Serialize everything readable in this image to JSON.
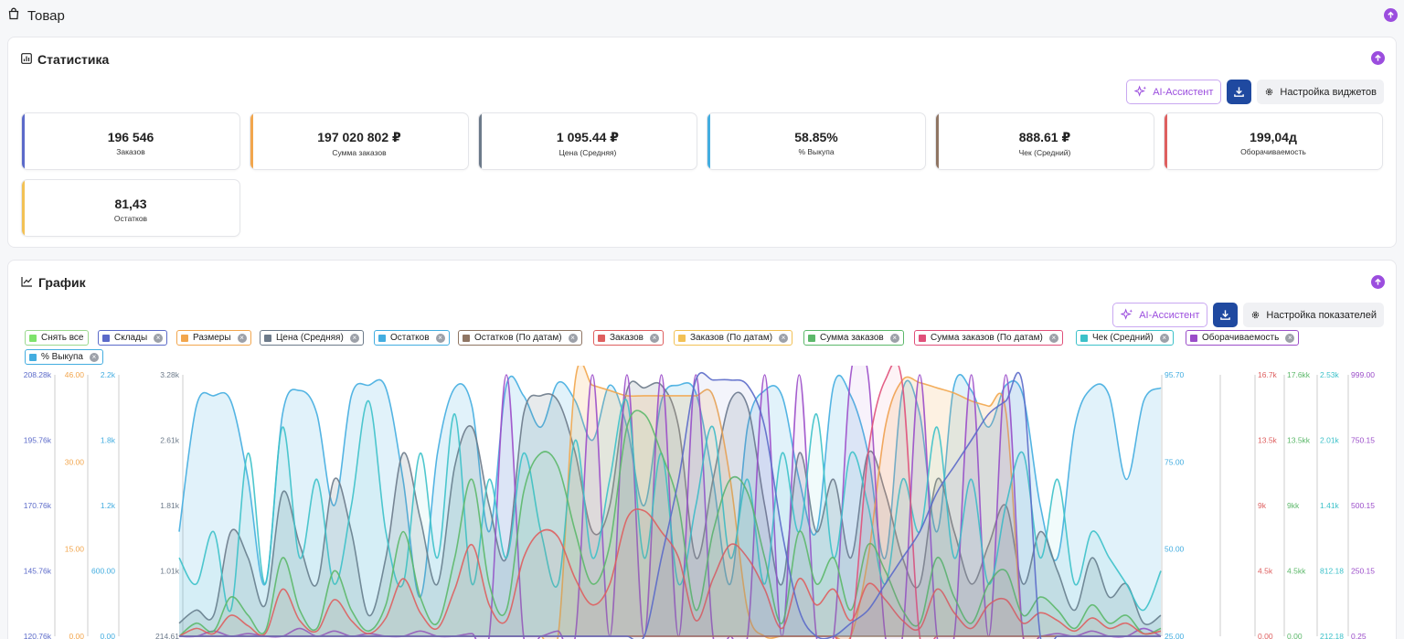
{
  "header": {
    "title": "Товар"
  },
  "stats": {
    "title": "Статистика",
    "ai_label": "AI-Ассистент",
    "settings_label": "Настройка виджетов",
    "metrics": [
      {
        "value": "196 546",
        "label": "Заказов",
        "color": "#5b6ac9"
      },
      {
        "value": "197 020 802 ₽",
        "label": "Сумма заказов",
        "color": "#f2a64d"
      },
      {
        "value": "1 095.44 ₽",
        "label": "Цена (Средняя)",
        "color": "#6c7a8a"
      },
      {
        "value": "58.85%",
        "label": "% Выкупа",
        "color": "#43ade0"
      },
      {
        "value": "888.61 ₽",
        "label": "Чек (Средний)",
        "color": "#8f7563"
      },
      {
        "value": "199,04д",
        "label": "Оборачиваемость",
        "color": "#de5f5f"
      },
      {
        "value": "81,43",
        "label": "Остатков",
        "color": "#f2c155"
      }
    ]
  },
  "graph": {
    "title": "График",
    "ai_label": "AI-Ассистент",
    "settings_label": "Настройка показателей",
    "chips": [
      {
        "label": "Снять все",
        "color": "#7ee36b",
        "border": "#9bd88f",
        "removable": false
      },
      {
        "label": "Склады",
        "color": "#5b6ac9",
        "border": "#5b6ac9",
        "removable": true
      },
      {
        "label": "Размеры",
        "color": "#f2a64d",
        "border": "#f2a64d",
        "removable": true
      },
      {
        "label": "Цена (Средняя)",
        "color": "#6c7a8a",
        "border": "#6c7a8a",
        "removable": true
      },
      {
        "label": "Остатков",
        "color": "#43ade0",
        "border": "#43ade0",
        "removable": true
      },
      {
        "label": "Остатков (По датам)",
        "color": "#8f7563",
        "border": "#8f7563",
        "removable": true
      },
      {
        "label": "Заказов",
        "color": "#de5f5f",
        "border": "#de5f5f",
        "removable": true
      },
      {
        "label": "Заказов (По датам)",
        "color": "#f2c155",
        "border": "#f2c155",
        "removable": true
      },
      {
        "label": "Сумма заказов",
        "color": "#5cb86a",
        "border": "#5cb86a",
        "removable": true
      },
      {
        "label": "Сумма заказов (По датам)",
        "color": "#e0507a",
        "border": "#e0507a",
        "removable": true
      },
      {
        "label": "Чек (Средний)",
        "color": "#3cc1c9",
        "border": "#3cc1c9",
        "removable": true
      },
      {
        "label": "Оборачиваемость",
        "color": "#9b4dc9",
        "border": "#9b4dc9",
        "removable": true
      },
      {
        "label": "% Выкупа",
        "color": "#43ade0",
        "border": "#43ade0",
        "removable": true
      }
    ]
  },
  "chart_data": {
    "type": "area",
    "left_axes": [
      {
        "color": "#5b6ac9",
        "ticks": [
          "208.28k",
          "195.76k",
          "170.76k",
          "145.76k",
          "120.76k"
        ]
      },
      {
        "color": "#f2a64d",
        "ticks": [
          "46.00",
          "30.00",
          "15.00",
          "0.00"
        ]
      },
      {
        "color": "#43ade0",
        "ticks": [
          "2.2k",
          "1.8k",
          "1.2k",
          "600.00",
          "0.00"
        ]
      },
      {
        "color": "#6c7a8a",
        "ticks": [
          "3.28k",
          "2.61k",
          "1.81k",
          "1.01k",
          "214.61"
        ]
      }
    ],
    "right_axes": [
      {
        "color": "#43ade0",
        "ticks": [
          "95.70",
          "75.00",
          "50.00",
          "25.00"
        ]
      },
      {
        "color": "#de5f5f",
        "ticks": [
          "16.7k",
          "13.5k",
          "9k",
          "4.5k",
          "0.00"
        ]
      },
      {
        "color": "#5cb86a",
        "ticks": [
          "17.6kk",
          "13.5kk",
          "9kk",
          "4.5kk",
          "0.00"
        ]
      },
      {
        "color": "#3cc1c9",
        "ticks": [
          "2.53k",
          "2.01k",
          "1.41k",
          "812.18",
          "212.18"
        ]
      },
      {
        "color": "#9b4dc9",
        "ticks": [
          "999.00",
          "750.15",
          "500.15",
          "250.15",
          "0.25"
        ]
      }
    ],
    "series": [
      {
        "color": "#43ade0",
        "values": [
          40,
          88,
          92,
          90,
          60,
          20,
          85,
          94,
          85,
          50,
          92,
          96,
          95,
          60,
          15,
          70,
          95,
          88,
          40,
          96,
          92,
          80,
          97,
          90,
          75,
          96,
          80,
          50,
          90,
          96,
          93,
          60,
          20,
          80,
          94,
          92,
          60,
          40,
          96,
          92,
          70,
          30,
          94,
          85,
          40,
          96,
          94,
          80,
          96,
          92,
          50,
          30,
          80,
          95,
          92,
          60,
          90,
          95
        ]
      },
      {
        "color": "#6c7a8a",
        "values": [
          5,
          10,
          8,
          40,
          30,
          12,
          55,
          35,
          20,
          60,
          40,
          8,
          30,
          70,
          45,
          20,
          65,
          80,
          50,
          30,
          85,
          92,
          90,
          70,
          40,
          50,
          94,
          95,
          96,
          80,
          30,
          60,
          90,
          88,
          50,
          20,
          70,
          40,
          60,
          30,
          70,
          55,
          30,
          20,
          60,
          40,
          20,
          35,
          50,
          20,
          40,
          25,
          10,
          30,
          15,
          20,
          5,
          8
        ]
      },
      {
        "color": "#f2a64d",
        "values": [
          0,
          0,
          0,
          0,
          0,
          0,
          0,
          0,
          0,
          0,
          0,
          0,
          0,
          0,
          0,
          0,
          0,
          0,
          0,
          0,
          0,
          0,
          0,
          98,
          96,
          94,
          92,
          92,
          92,
          92,
          92,
          92,
          60,
          10,
          0,
          0,
          0,
          0,
          0,
          0,
          30,
          80,
          98,
          97,
          95,
          93,
          90,
          88,
          86,
          0,
          0,
          0,
          0,
          0,
          0,
          0,
          0,
          0
        ]
      },
      {
        "color": "#9b4dc9",
        "values": [
          0,
          0,
          2,
          0,
          1,
          0,
          0,
          3,
          0,
          2,
          0,
          1,
          0,
          0,
          2,
          0,
          0,
          1,
          0,
          100,
          0,
          0,
          2,
          0,
          100,
          0,
          100,
          0,
          100,
          0,
          100,
          0,
          0,
          0,
          100,
          0,
          100,
          0,
          0,
          100,
          100,
          0,
          0,
          100,
          0,
          0,
          100,
          0,
          100,
          0,
          0,
          1,
          0,
          2,
          0,
          0,
          3,
          0
        ]
      },
      {
        "color": "#3cc1c9",
        "values": [
          30,
          20,
          40,
          10,
          70,
          20,
          80,
          30,
          60,
          20,
          50,
          90,
          40,
          20,
          70,
          30,
          85,
          20,
          60,
          30,
          70,
          40,
          20,
          75,
          30,
          60,
          90,
          30,
          70,
          20,
          50,
          80,
          30,
          60,
          20,
          70,
          40,
          85,
          30,
          70,
          50,
          20,
          60,
          40,
          80,
          30,
          60,
          20,
          50,
          70,
          30,
          60,
          20,
          40,
          30,
          20,
          10,
          25
        ]
      },
      {
        "color": "#5cb86a",
        "values": [
          0,
          5,
          2,
          15,
          8,
          2,
          30,
          10,
          3,
          25,
          10,
          2,
          12,
          40,
          15,
          5,
          30,
          60,
          20,
          10,
          55,
          70,
          65,
          40,
          20,
          35,
          80,
          85,
          70,
          50,
          10,
          40,
          60,
          55,
          30,
          5,
          40,
          20,
          30,
          10,
          35,
          25,
          10,
          5,
          30,
          15,
          5,
          20,
          25,
          8,
          15,
          10,
          3,
          12,
          5,
          8,
          1,
          3
        ]
      },
      {
        "color": "#de5f5f",
        "values": [
          0,
          3,
          1,
          8,
          4,
          1,
          18,
          6,
          2,
          14,
          6,
          1,
          7,
          22,
          9,
          3,
          18,
          35,
          12,
          6,
          30,
          40,
          38,
          22,
          12,
          20,
          45,
          48,
          40,
          30,
          6,
          22,
          35,
          30,
          18,
          3,
          22,
          12,
          18,
          6,
          20,
          14,
          6,
          3,
          18,
          9,
          3,
          12,
          14,
          5,
          9,
          6,
          2,
          7,
          3,
          5,
          1,
          2
        ]
      },
      {
        "color": "#e0507a",
        "values": [
          0,
          0,
          0,
          0,
          0,
          0,
          0,
          0,
          0,
          0,
          0,
          0,
          0,
          0,
          0,
          0,
          0,
          0,
          0,
          0,
          0,
          0,
          0,
          0,
          0,
          0,
          0,
          0,
          0,
          0,
          0,
          0,
          0,
          0,
          0,
          0,
          0,
          0,
          0,
          0,
          70,
          98,
          96,
          0,
          0,
          0,
          0,
          0,
          0,
          0,
          0,
          0,
          0,
          0,
          0,
          0,
          0,
          0
        ]
      },
      {
        "color": "#8f7563",
        "values": [
          0,
          0,
          0,
          0,
          0,
          0,
          0,
          0,
          0,
          0,
          0,
          0,
          0,
          0,
          0,
          0,
          0,
          0,
          0,
          0,
          0,
          0,
          0,
          0,
          0,
          0,
          0,
          0,
          0,
          0,
          0,
          0,
          0,
          0,
          0,
          0,
          0,
          0,
          0,
          0,
          0,
          0,
          0,
          0,
          0,
          0,
          0,
          0,
          0,
          0,
          0,
          0,
          0,
          0,
          0,
          0,
          0,
          0
        ]
      },
      {
        "color": "#5b6ac9",
        "values": [
          0,
          0,
          0,
          0,
          0,
          0,
          0,
          0,
          0,
          0,
          0,
          0,
          0,
          0,
          0,
          0,
          0,
          0,
          0,
          0,
          0,
          0,
          0,
          0,
          0,
          0,
          0,
          0,
          30,
          60,
          98,
          98,
          98,
          96,
          80,
          40,
          10,
          0,
          0,
          5,
          10,
          20,
          30,
          40,
          55,
          65,
          75,
          85,
          90,
          95,
          0,
          0,
          0,
          0,
          0,
          0,
          0,
          0
        ]
      }
    ]
  }
}
